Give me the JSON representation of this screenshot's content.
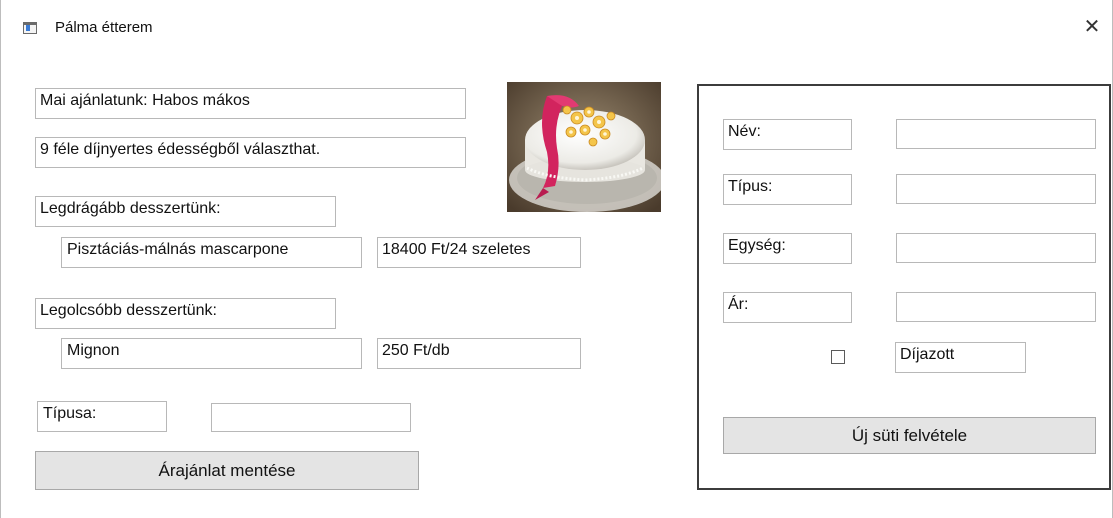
{
  "window": {
    "title": "Pálma étterem",
    "close_glyph": "✕",
    "icon": "app-window-icon"
  },
  "left": {
    "offer_text": "Mai ajánlatunk: Habos mákos",
    "choice_text": "9 féle díjnyertes édességből választhat.",
    "priciest_label": "Legdrágább desszertünk:",
    "priciest_name": "Pisztáciás-málnás mascarpone",
    "priciest_price": "18400 Ft/24 szeletes",
    "cheapest_label": "Legolcsóbb desszertünk:",
    "cheapest_name": "Mignon",
    "cheapest_price": "250 Ft/db",
    "type_label": "Típusa:",
    "type_value": "",
    "save_button": "Árajánlat mentése"
  },
  "image": {
    "subject": "decorated-cake-photo"
  },
  "form": {
    "name_label": "Név:",
    "name_value": "",
    "type_label": "Típus:",
    "type_value": "",
    "unit_label": "Egység:",
    "unit_value": "",
    "price_label": "Ár:",
    "price_value": "",
    "awarded_checked": false,
    "awarded_label": "Díjazott",
    "add_button": "Új süti felvétele"
  },
  "colors": {
    "button_bg": "#e4e4e4",
    "field_border": "#b8b8b8",
    "panel_border": "#3c3c3c"
  }
}
